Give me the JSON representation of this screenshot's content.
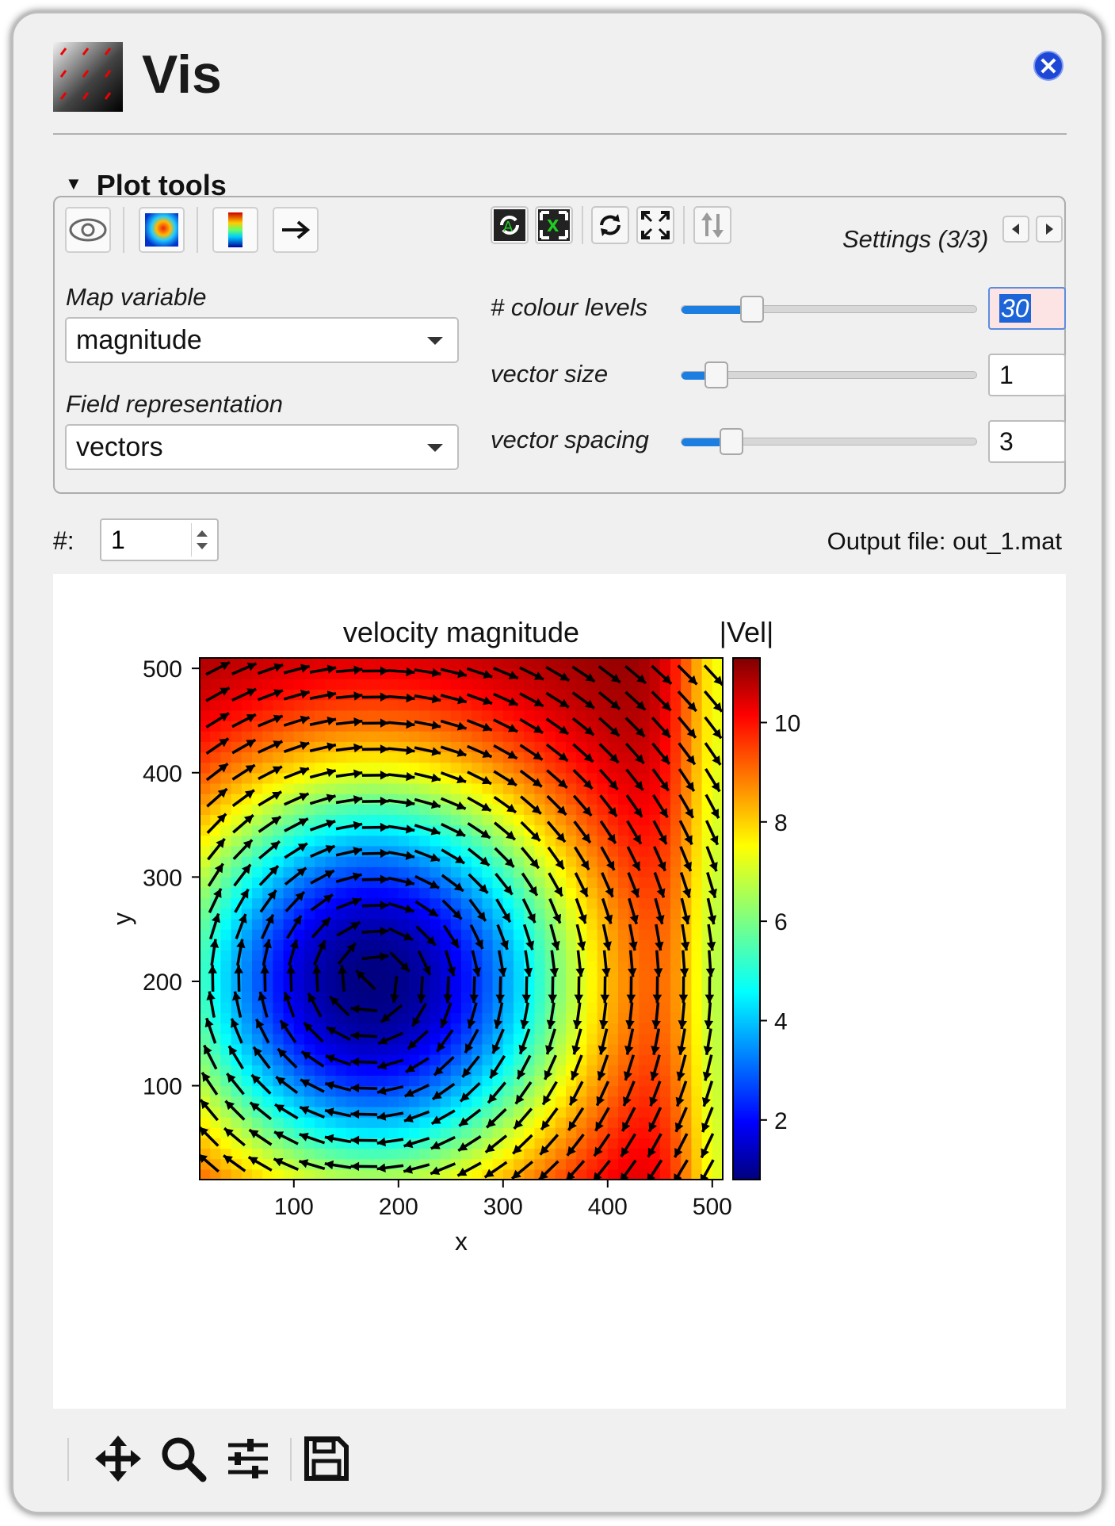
{
  "window": {
    "title": "Vis",
    "close_icon": "close-icon"
  },
  "plot_tools": {
    "header": "Plot tools",
    "settings_label": "Settings (3/3)",
    "map_variable_label": "Map variable",
    "map_variable_value": "magnitude",
    "field_representation_label": "Field representation",
    "field_representation_value": "vectors",
    "toolbar_icons": [
      "eye-icon",
      "heatmap-icon",
      "colorbar-icon",
      "arrow-right-icon",
      "refresh-axes-icon",
      "reset-axes-icon",
      "refresh-icon",
      "fullscreen-icon",
      "swap-vertical-icon"
    ],
    "sliders": [
      {
        "label": "# colour levels",
        "value": "30",
        "fraction": 0.24
      },
      {
        "label": "vector size",
        "value": "1",
        "fraction": 0.12
      },
      {
        "label": "vector spacing",
        "value": "3",
        "fraction": 0.17
      }
    ],
    "accent_color": "#1c7ee0"
  },
  "record": {
    "label": "#:",
    "value": "1",
    "output_file": "Output file: out_1.mat"
  },
  "chart_data": {
    "type": "heatmap",
    "title": "velocity magnitude",
    "colorbar_label": "|Vel|",
    "xlabel": "x",
    "ylabel": "y",
    "xlim": [
      10,
      510
    ],
    "ylim": [
      10,
      510
    ],
    "xticks": [
      "100",
      "200",
      "300",
      "400",
      "500"
    ],
    "yticks": [
      "100",
      "200",
      "300",
      "400",
      "500"
    ],
    "colorbar_ticks": [
      "2",
      "4",
      "6",
      "8",
      "10"
    ],
    "colorbar_range": [
      0.8,
      11.3
    ],
    "colormap": "jet",
    "overlay": "vectors",
    "vortex_center": [
      175,
      200
    ]
  },
  "bottom_toolbar": [
    "move-icon",
    "zoom-icon",
    "settings-sliders-icon",
    "save-icon"
  ]
}
